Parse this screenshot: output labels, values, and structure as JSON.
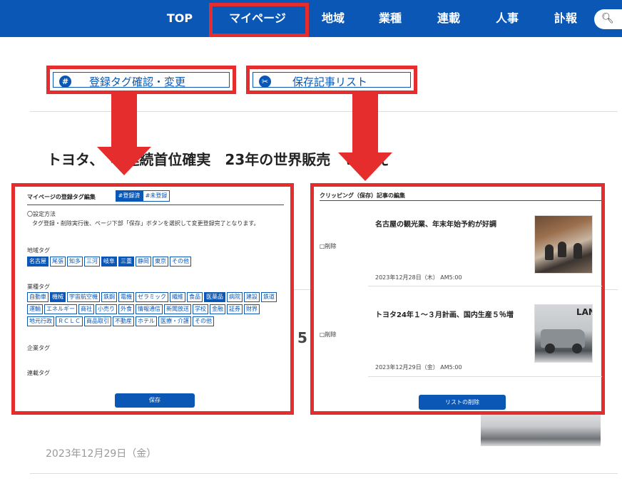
{
  "nav": {
    "items": [
      "TOP",
      "マイページ",
      "地域",
      "業種",
      "連載",
      "人事",
      "訃報"
    ],
    "active": "マイページ",
    "search_icon": "magnifier-icon"
  },
  "buttons": {
    "tag_icon": "#",
    "tag_label": "登録タグ確認・変更",
    "clip_icon": "✂",
    "clip_label": "保存記事リスト"
  },
  "article": {
    "title": "トヨタ、　年連続首位確実　23年の世界販売　W抑え",
    "number": "5",
    "date": "2023年12月29日（金）"
  },
  "tag_editor": {
    "heading": "マイページの登録タグ編集",
    "tab_registered": "#登録済",
    "tab_unregistered": "#未登録",
    "method_title": "〇設定方法",
    "method_desc": "タグ登録・削除実行後、ページ下部「保存」ボタンを選択して変更登録完了となります。",
    "region_label": "地域タグ",
    "region_tags": [
      {
        "t": "名古屋",
        "on": true
      },
      {
        "t": "尾張",
        "on": false
      },
      {
        "t": "知多",
        "on": false
      },
      {
        "t": "三河",
        "on": false
      },
      {
        "t": "岐阜",
        "on": true
      },
      {
        "t": "三重",
        "on": true
      },
      {
        "t": "静岡",
        "on": false
      },
      {
        "t": "東京",
        "on": false
      },
      {
        "t": "その他",
        "on": false
      }
    ],
    "industry_label": "業種タグ",
    "industry_rows": [
      [
        {
          "t": "自動車",
          "on": false
        },
        {
          "t": "機械",
          "on": true
        },
        {
          "t": "宇宙航空機",
          "on": false
        },
        {
          "t": "鉄鋼",
          "on": false
        },
        {
          "t": "電機",
          "on": false
        },
        {
          "t": "ゼラミック",
          "on": false
        },
        {
          "t": "繊維",
          "on": false
        },
        {
          "t": "食品",
          "on": false
        },
        {
          "t": "医薬品",
          "on": true
        },
        {
          "t": "病院",
          "on": false
        },
        {
          "t": "建設",
          "on": false
        },
        {
          "t": "鉄道",
          "on": false
        }
      ],
      [
        {
          "t": "運輸",
          "on": false
        },
        {
          "t": "エネルギー",
          "on": false
        },
        {
          "t": "商社",
          "on": false
        },
        {
          "t": "小売り",
          "on": false
        },
        {
          "t": "外食",
          "on": false
        },
        {
          "t": "情報通信",
          "on": false
        },
        {
          "t": "新聞放送",
          "on": false
        },
        {
          "t": "学校",
          "on": false
        },
        {
          "t": "金融",
          "on": false
        },
        {
          "t": "証券",
          "on": false
        },
        {
          "t": "財界",
          "on": false
        }
      ],
      [
        {
          "t": "地元行政",
          "on": false
        },
        {
          "t": "ＲＣＬＣ",
          "on": false
        },
        {
          "t": "商品取引",
          "on": false
        },
        {
          "t": "不動産",
          "on": false
        },
        {
          "t": "ホテル",
          "on": false
        },
        {
          "t": "医療・介護",
          "on": false
        },
        {
          "t": "その他",
          "on": false
        }
      ]
    ],
    "company_label": "企業タグ",
    "series_label": "連載タグ",
    "save_label": "保存"
  },
  "clipping": {
    "heading": "クリッピング（保存）記事の編集",
    "items": [
      {
        "delete_label": "□削除",
        "title": "名古屋の観光業、年末年始予約が好調",
        "date": "2023年12月28日（木） AM5:00"
      },
      {
        "delete_label": "□削除",
        "title": "トヨタ24年１～３月計画、国内生産５％増",
        "date": "2023年12月29日（金） AM5:00",
        "thumb_text": "LAN"
      }
    ],
    "list_delete_label": "リストの削除"
  },
  "colors": {
    "brand": "#0b57b5",
    "highlight": "#e52d2d"
  }
}
